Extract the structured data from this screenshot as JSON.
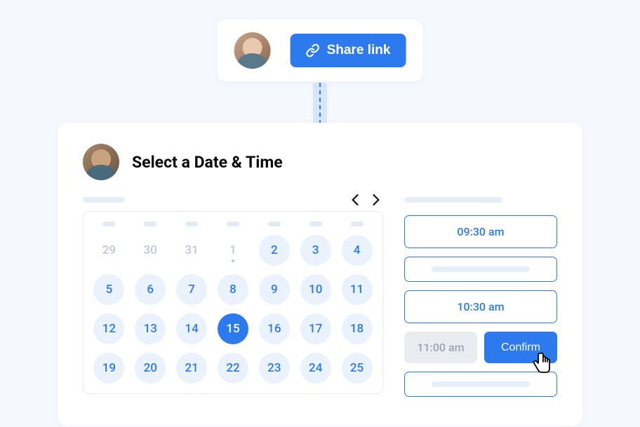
{
  "share": {
    "button_label": "Share link"
  },
  "scheduler": {
    "title": "Select a Date & Time",
    "nav": {
      "prev": "‹",
      "next": "›"
    },
    "calendar": {
      "days": [
        {
          "n": "29",
          "state": "disabled"
        },
        {
          "n": "30",
          "state": "disabled"
        },
        {
          "n": "31",
          "state": "disabled"
        },
        {
          "n": "1",
          "state": "disabled",
          "dot": true
        },
        {
          "n": "2",
          "state": "available"
        },
        {
          "n": "3",
          "state": "available"
        },
        {
          "n": "4",
          "state": "available"
        },
        {
          "n": "5",
          "state": "available"
        },
        {
          "n": "6",
          "state": "available"
        },
        {
          "n": "7",
          "state": "available"
        },
        {
          "n": "8",
          "state": "available"
        },
        {
          "n": "9",
          "state": "available"
        },
        {
          "n": "10",
          "state": "available"
        },
        {
          "n": "11",
          "state": "available"
        },
        {
          "n": "12",
          "state": "available"
        },
        {
          "n": "13",
          "state": "available"
        },
        {
          "n": "14",
          "state": "available"
        },
        {
          "n": "15",
          "state": "selected"
        },
        {
          "n": "16",
          "state": "available"
        },
        {
          "n": "17",
          "state": "available"
        },
        {
          "n": "18",
          "state": "available"
        },
        {
          "n": "19",
          "state": "available"
        },
        {
          "n": "20",
          "state": "available"
        },
        {
          "n": "21",
          "state": "available"
        },
        {
          "n": "22",
          "state": "available"
        },
        {
          "n": "23",
          "state": "available"
        },
        {
          "n": "24",
          "state": "available"
        },
        {
          "n": "25",
          "state": "available"
        }
      ]
    },
    "time_slots": [
      {
        "label": "09:30 am",
        "type": "time"
      },
      {
        "label": "",
        "type": "placeholder"
      },
      {
        "label": "10:30 am",
        "type": "time"
      }
    ],
    "selected_time": "11:00 am",
    "confirm_label": "Confirm"
  },
  "colors": {
    "primary": "#2d7aef",
    "available_bg": "#eaf2fd",
    "disabled": "#bfc8d6"
  }
}
